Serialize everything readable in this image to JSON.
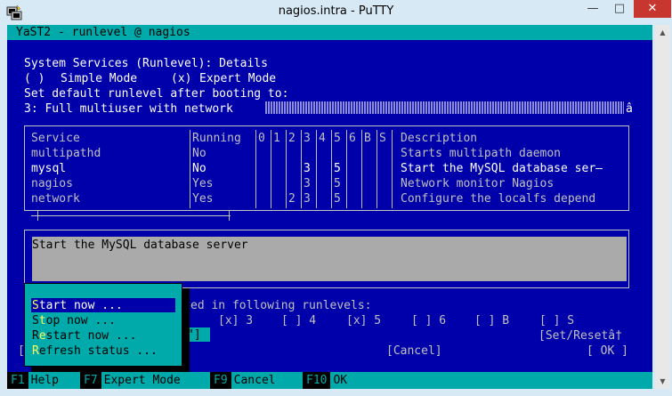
{
  "window": {
    "title": "nagios.intra - PuTTY",
    "minimize": "—",
    "maximize": "□",
    "close": "✕",
    "icon": "putty-icon"
  },
  "yast": {
    "header": "YaST2 - runlevel @ nagios",
    "screen_title": "System Services (Runlevel): Details",
    "simple_mode_radio": "( )",
    "simple_mode": "Simple Mode",
    "expert_mode_radio": "(x)",
    "expert_mode": "Expert Mode",
    "default_runlevel_label": "Set default runlevel after booting to:",
    "default_runlevel_value": "3: Full multiuser with network",
    "default_runlevel_arrow": "â"
  },
  "table": {
    "columns": [
      "Service",
      "Running",
      "0",
      "1",
      "2",
      "3",
      "4",
      "5",
      "6",
      "B",
      "S",
      "Description"
    ],
    "rows": [
      {
        "service": "multipathd",
        "running": "No",
        "r2": "",
        "r3": "",
        "r5": "",
        "description": "Starts multipath daemon"
      },
      {
        "service": "mysql",
        "running": "No",
        "r2": "",
        "r3": "3",
        "r5": "5",
        "description": "Start the MySQL database ser—"
      },
      {
        "service": "nagios",
        "running": "Yes",
        "r2": "",
        "r3": "3",
        "r5": "5",
        "description": "Network monitor Nagios"
      },
      {
        "service": "network",
        "running": "Yes",
        "r2": "2",
        "r3": "3",
        "r5": "5",
        "description": "Configure the localfs depend"
      }
    ]
  },
  "description_text": "Start the MySQL database server",
  "runlevels": {
    "label": "ed in following runlevels:",
    "rl3": "[x] 3",
    "rl4": "[ ] 4",
    "rl5": "[x] 5",
    "rl6": "[ ] 6",
    "rlB": "[ ] B",
    "rlS": "[ ] S"
  },
  "input_value": "\"]",
  "set_reset": "[Set/Resetâ†",
  "cancel_button": "[Cancel]",
  "ok_button": "[ OK ]",
  "left_bracket": "[",
  "popup_menu": [
    {
      "hotkey": "S",
      "rest": "tart now ...",
      "selected": true
    },
    {
      "hotkey_prefix": "S",
      "hotkey": "t",
      "rest": "op now ...",
      "selected": false
    },
    {
      "hotkey_prefix": "R",
      "hotkey": "e",
      "rest": "start now ...",
      "selected": false
    },
    {
      "hotkey": "R",
      "rest": "efresh status ...",
      "selected": false
    }
  ],
  "fkeys": [
    {
      "key": "F1",
      "label": "Help"
    },
    {
      "key": "F7",
      "label": "Expert Mode"
    },
    {
      "key": "F9",
      "label": "Cancel"
    },
    {
      "key": "F10",
      "label": "OK"
    }
  ],
  "colors": {
    "terminal_bg": "#0000aa",
    "accent_cyan": "#00aaaa",
    "text": "#ffffff",
    "hotkey": "#ffff55",
    "close_button": "#c7372f"
  }
}
